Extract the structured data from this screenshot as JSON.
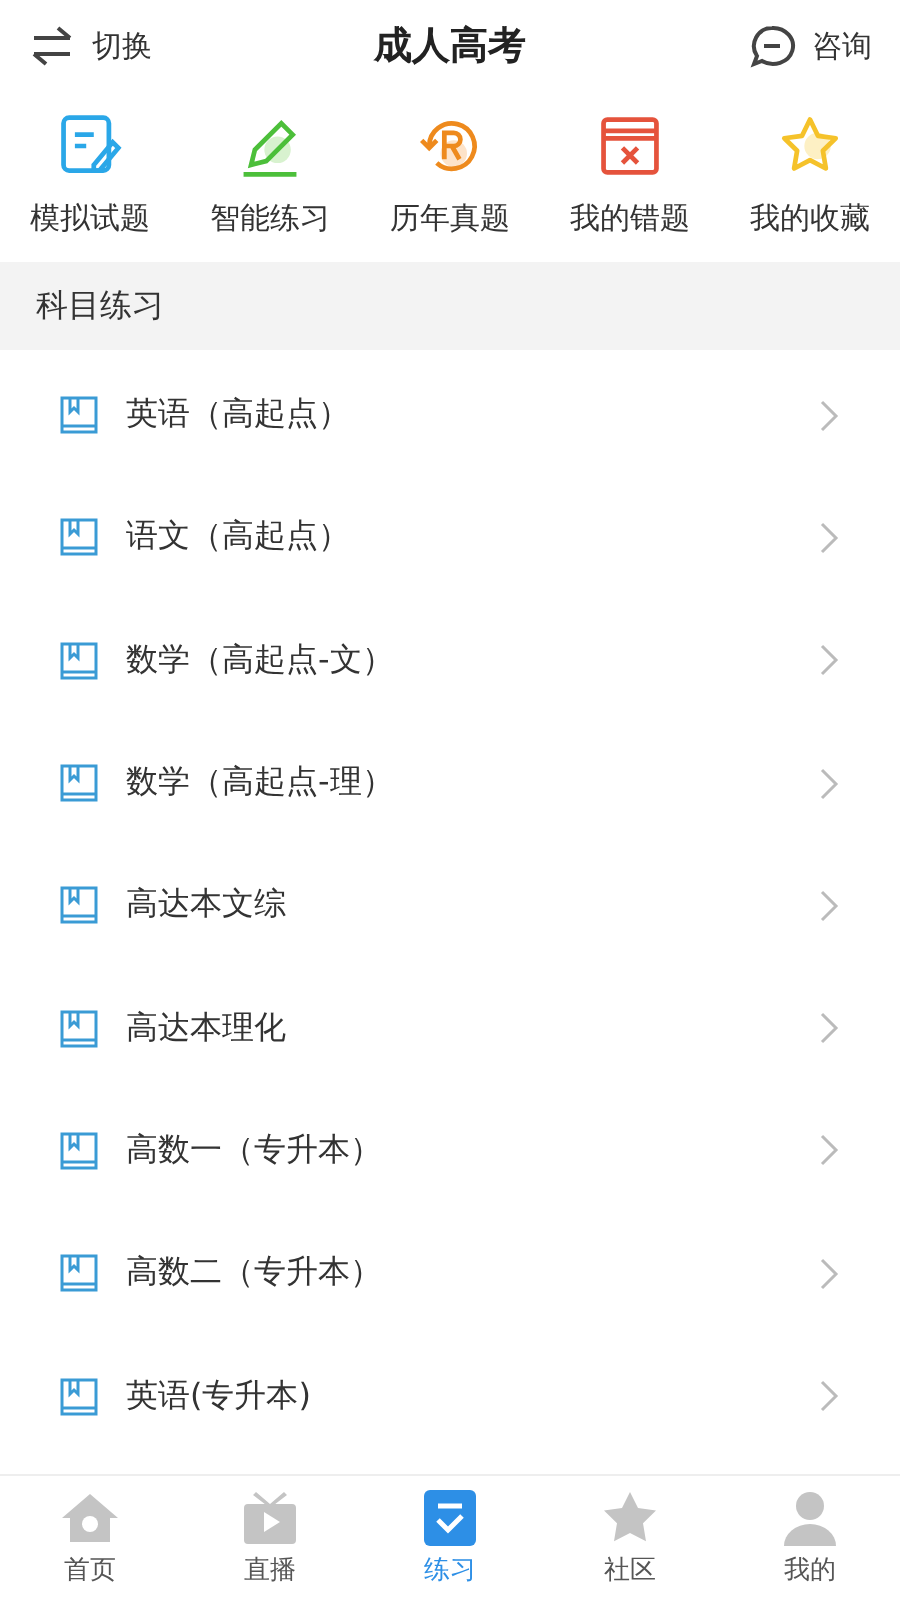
{
  "header": {
    "switch_label": "切换",
    "title": "成人高考",
    "consult_label": "咨询"
  },
  "shortcuts": [
    {
      "kind": "exam",
      "label": "模拟试题"
    },
    {
      "kind": "pencil",
      "label": "智能练习"
    },
    {
      "kind": "history",
      "label": "历年真题"
    },
    {
      "kind": "wrong",
      "label": "我的错题"
    },
    {
      "kind": "star",
      "label": "我的收藏"
    }
  ],
  "section_title": "科目练习",
  "subjects": [
    "英语（高起点）",
    "语文（高起点）",
    "数学（高起点-文）",
    "数学（高起点-理）",
    "高达本文综",
    "高达本理化",
    "高数一（专升本）",
    "高数二（专升本）",
    "英语(专升本)"
  ],
  "tabs": [
    {
      "kind": "home",
      "label": "首页",
      "selected": false
    },
    {
      "kind": "live",
      "label": "直播",
      "selected": false
    },
    {
      "kind": "practice",
      "label": "练习",
      "selected": true
    },
    {
      "kind": "community",
      "label": "社区",
      "selected": false
    },
    {
      "kind": "me",
      "label": "我的",
      "selected": false
    }
  ]
}
